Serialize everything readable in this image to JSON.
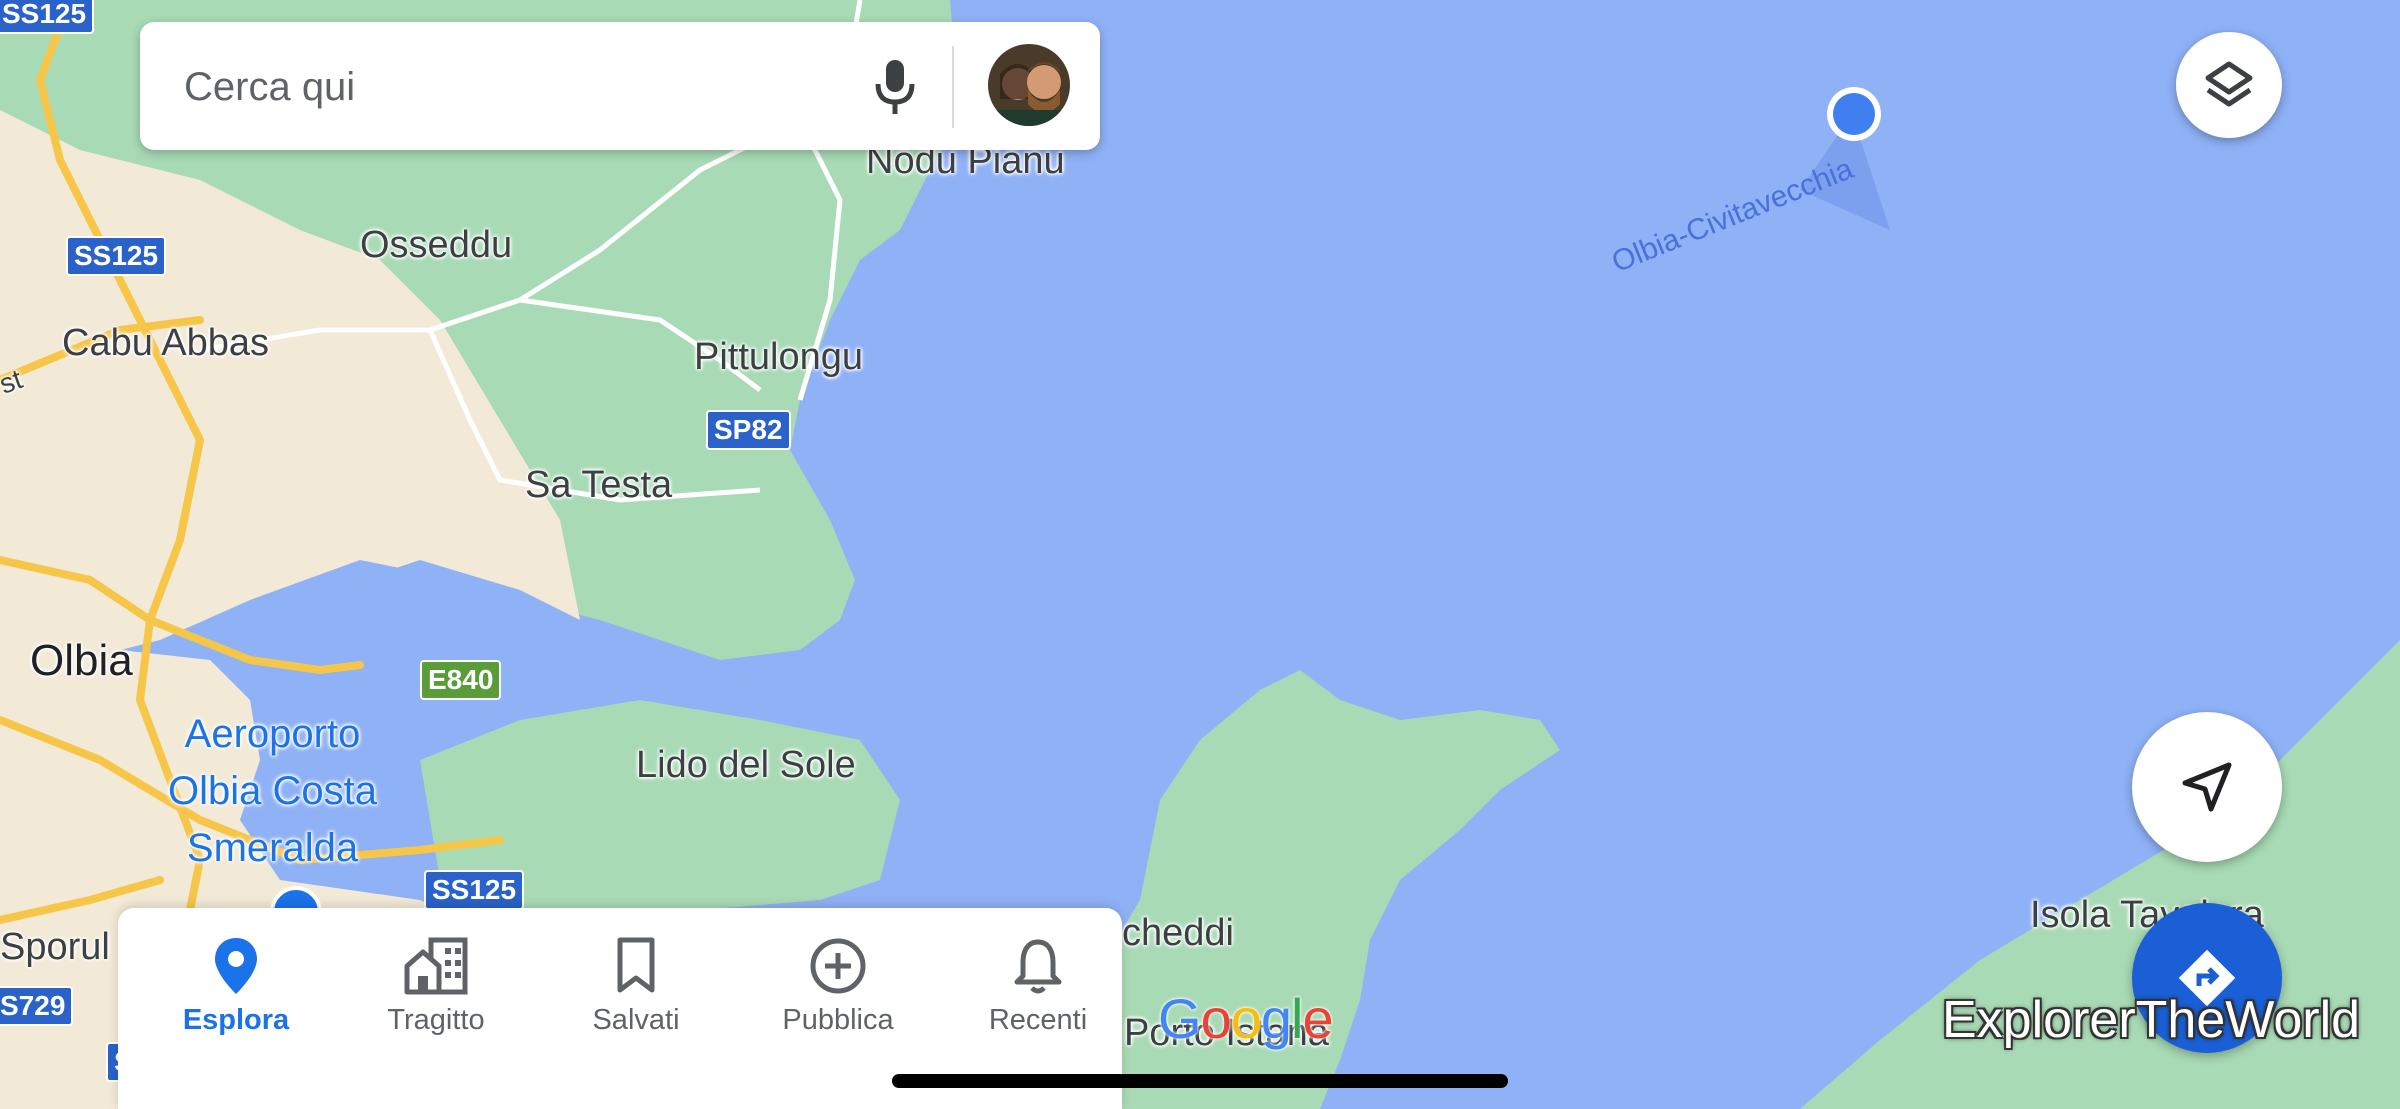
{
  "search": {
    "placeholder": "Cerca qui"
  },
  "map": {
    "places": {
      "osseddu": "Osseddu",
      "cabu_abbas": "Cabu Abbas",
      "pittulongu": "Pittulongu",
      "sa_testa": "Sa Testa",
      "olbia": "Olbia",
      "lido_del_sole": "Lido del Sole",
      "nodu_pianu": "Nodu Pianu",
      "sporul": "Sporul",
      "cheddi": "cheddi",
      "porto_istana": "Porto Istana",
      "isola_tavolara": "Isola Tavolara",
      "st": "st"
    },
    "airport": [
      "Aeroporto",
      "Olbia Costa",
      "Smeralda"
    ],
    "ferry_route": "Olbia-Civitavecchia",
    "road_shields": {
      "ss125_top": "SS125",
      "ss125_mid": "SS125",
      "sp82": "SP82",
      "e840": "E840",
      "ss125_bottom": "SS125",
      "s729": "S729",
      "s_edge": "S"
    }
  },
  "icons": {
    "mic": "mic-icon",
    "layers": "layers-icon",
    "locate": "navigation-arrow-icon",
    "directions": "directions-icon"
  },
  "bottom_nav": {
    "items": [
      {
        "label": "Esplora",
        "icon": "location-pin-icon",
        "active": true
      },
      {
        "label": "Tragitto",
        "icon": "commute-icon",
        "active": false
      },
      {
        "label": "Salvati",
        "icon": "bookmark-icon",
        "active": false
      },
      {
        "label": "Pubblica",
        "icon": "add-circle-icon",
        "active": false
      },
      {
        "label": "Recenti",
        "icon": "bell-icon",
        "active": false
      }
    ]
  },
  "logo": "Google",
  "watermark": "ExplorerTheWorld",
  "colors": {
    "water": "#8fb1f6",
    "land_green": "#a8dab5",
    "land_beige": "#f2e9d6",
    "road_yellow": "#f6c649",
    "accent_blue": "#1a73e8",
    "shield_blue": "#2a62c9",
    "shield_green": "#5b9c3a"
  }
}
